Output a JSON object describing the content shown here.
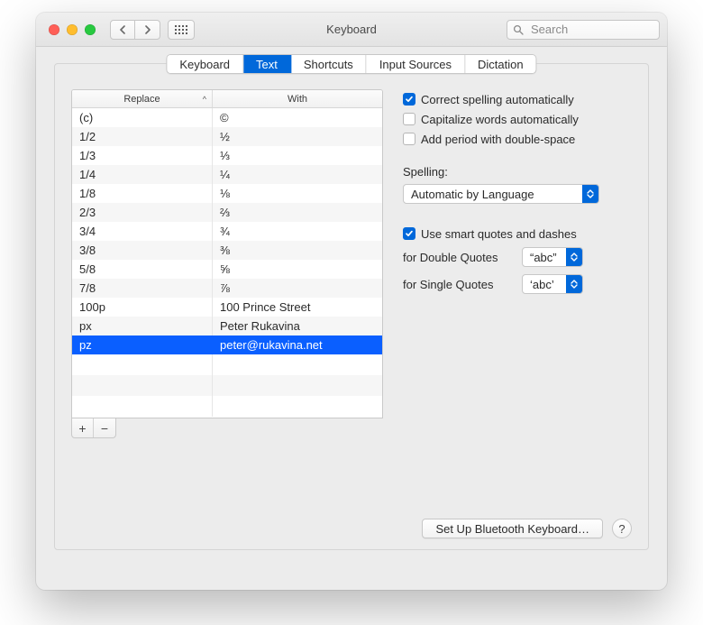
{
  "window": {
    "title": "Keyboard"
  },
  "search": {
    "placeholder": "Search"
  },
  "tabs": [
    {
      "label": "Keyboard"
    },
    {
      "label": "Text"
    },
    {
      "label": "Shortcuts"
    },
    {
      "label": "Input Sources"
    },
    {
      "label": "Dictation"
    }
  ],
  "active_tab_index": 1,
  "table": {
    "headers": {
      "replace": "Replace",
      "with": "With"
    },
    "sort_indicator": "^",
    "rows": [
      {
        "replace": "(c)",
        "with": "©"
      },
      {
        "replace": "1/2",
        "with": "½"
      },
      {
        "replace": "1/3",
        "with": "⅓"
      },
      {
        "replace": "1/4",
        "with": "¼"
      },
      {
        "replace": "1/8",
        "with": "⅛"
      },
      {
        "replace": "2/3",
        "with": "⅔"
      },
      {
        "replace": "3/4",
        "with": "¾"
      },
      {
        "replace": "3/8",
        "with": "⅜"
      },
      {
        "replace": "5/8",
        "with": "⅝"
      },
      {
        "replace": "7/8",
        "with": "⅞"
      },
      {
        "replace": "100p",
        "with": "100 Prince Street"
      },
      {
        "replace": "px",
        "with": "Peter Rukavina"
      },
      {
        "replace": "pz",
        "with": "peter@rukavina.net"
      }
    ],
    "selected_index": 12
  },
  "options": {
    "correct_spelling": {
      "label": "Correct spelling automatically",
      "checked": true
    },
    "capitalize_words": {
      "label": "Capitalize words automatically",
      "checked": false
    },
    "add_period": {
      "label": "Add period with double-space",
      "checked": false
    },
    "spelling_label": "Spelling:",
    "spelling_value": "Automatic by Language",
    "smart_quotes": {
      "label": "Use smart quotes and dashes",
      "checked": true
    },
    "double_quotes_label": "for Double Quotes",
    "double_quotes_value": "“abc”",
    "single_quotes_label": "for Single Quotes",
    "single_quotes_value": "‘abc’"
  },
  "footer": {
    "bluetooth_button": "Set Up Bluetooth Keyboard…",
    "help": "?"
  },
  "glyphs": {
    "plus": "+",
    "minus": "−"
  }
}
